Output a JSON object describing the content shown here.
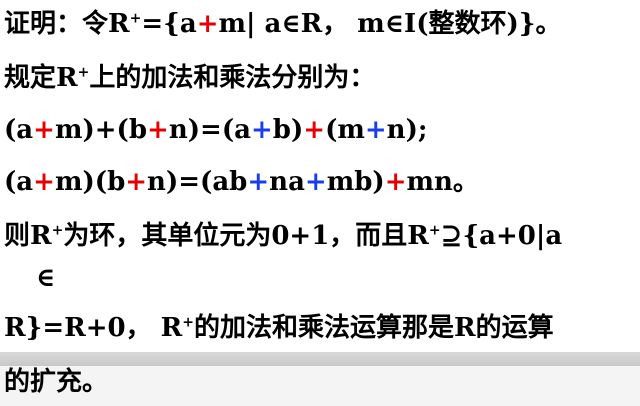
{
  "lines": {
    "l1": {
      "a": "证明：令R",
      "sup": "+",
      "b": "={a",
      "plus": "+",
      "c": "m| a∈R，  m∈I(整数环)}。"
    },
    "l2": {
      "a": "规定R",
      "sup": "+",
      "b": "上的加法和乘法分别为："
    },
    "l3": {
      "a": "(a",
      "p1": "+",
      "b": "m)+(b",
      "p2": "+",
      "c": "n)=(a",
      "p3": "+",
      "d": "b)",
      "p4": "+",
      "e": "(m",
      "p5": "+",
      "f": "n);"
    },
    "l4": {
      "a": "(a",
      "p1": "+",
      "b": "m)(b",
      "p2": "+",
      "c": "n)=(ab",
      "p3": "+",
      "d": "na",
      "p4": "+",
      "e": "mb)",
      "p5": "+",
      "f": "mn。"
    },
    "l5": {
      "a": "则R",
      "sup": "+",
      "b": "为环，其单位元为0+1，而且R",
      "sup2": "+",
      "c": "⊇{a+0|a"
    },
    "l5b": "∈",
    "l6": {
      "a": "R}=R+0，  R",
      "sup": "+",
      "b": "的加法和乘法运算那是R的运算"
    },
    "l7": "的扩充。"
  },
  "colors": {
    "text": "#000000",
    "red": "#e60000",
    "blue": "#1a3cf0",
    "band": "#d0d0d0"
  }
}
